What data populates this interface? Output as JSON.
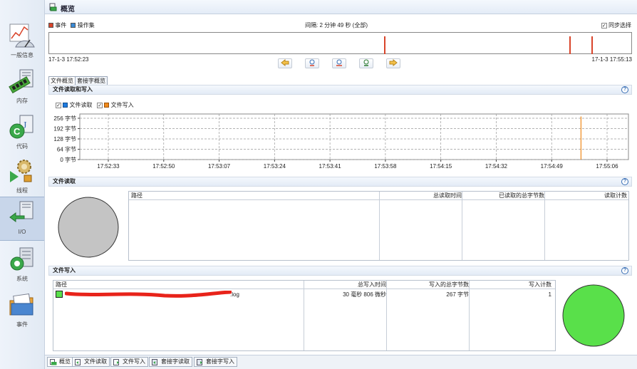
{
  "window": {
    "title": "概览"
  },
  "sidebar": {
    "items": [
      {
        "label": "一般信息",
        "icon": "chart-gauge-icon"
      },
      {
        "label": "内存",
        "icon": "memory-chip-icon"
      },
      {
        "label": "代码",
        "icon": "code-class-icon"
      },
      {
        "label": "线程",
        "icon": "thread-gears-icon"
      },
      {
        "label": "I/O",
        "icon": "io-arrows-icon"
      },
      {
        "label": "系统",
        "icon": "system-server-icon"
      },
      {
        "label": "事件",
        "icon": "events-folder-icon"
      }
    ],
    "active_index": 4
  },
  "timeline": {
    "legend_event": "事件",
    "legend_opset": "操作集",
    "interval": "间隔: 2 分钟 49 秒 (全部)",
    "sync_label": "同步选择",
    "sync_checked": true,
    "start_time": "17-1-3 17:52:23",
    "end_time": "17-1-3 17:55:13",
    "marks_fraction": [
      0.575,
      0.893,
      0.931
    ],
    "event_color": "#d9442a",
    "opset_color": "#3a8ad6"
  },
  "nav": [
    "back-arrow-icon",
    "zoom-in-icon",
    "zoom-out-icon",
    "zoom-fit-icon",
    "forward-arrow-icon"
  ],
  "top_tabs": [
    "文件概览",
    "套接字概览"
  ],
  "io_section": {
    "title": "文件读取和写入",
    "legend_read": "文件读取",
    "legend_write": "文件写入",
    "read_color": "#1e7be0",
    "write_color": "#f08a1c"
  },
  "chart_data": {
    "type": "line",
    "x": [
      "17:52:33",
      "17:52:50",
      "17:53:07",
      "17:53:24",
      "17:53:41",
      "17:53:58",
      "17:54:15",
      "17:54:32",
      "17:54:49",
      "17:55:06"
    ],
    "yticks": [
      "256 字节",
      "192 字节",
      "128 字节",
      "64 字节",
      "0 字节"
    ],
    "ylim": [
      0,
      256
    ],
    "series": [
      {
        "name": "文件读取",
        "values": []
      },
      {
        "name": "文件写入",
        "spike_at": "17:54:58",
        "value": 267
      }
    ],
    "grid": true
  },
  "read_section": {
    "title": "文件读取",
    "columns": [
      "路径",
      "总读取时间",
      "已读取的总字节数",
      "读取计数"
    ],
    "rows": [],
    "pie_color": "#c4c4c4"
  },
  "write_section": {
    "title": "文件写入",
    "columns": [
      "路径",
      "总写入时间",
      "写入的总字节数",
      "写入计数"
    ],
    "rows": [
      {
        "path": ".log",
        "time": "30 毫秒 806 微秒",
        "bytes": "267 字节",
        "count": "1",
        "color": "#59e04a"
      }
    ],
    "pie_color": "#59e04a"
  },
  "bottom_tabs": [
    "概览",
    "文件读取",
    "文件写入",
    "套接字读取",
    "套接字写入"
  ]
}
